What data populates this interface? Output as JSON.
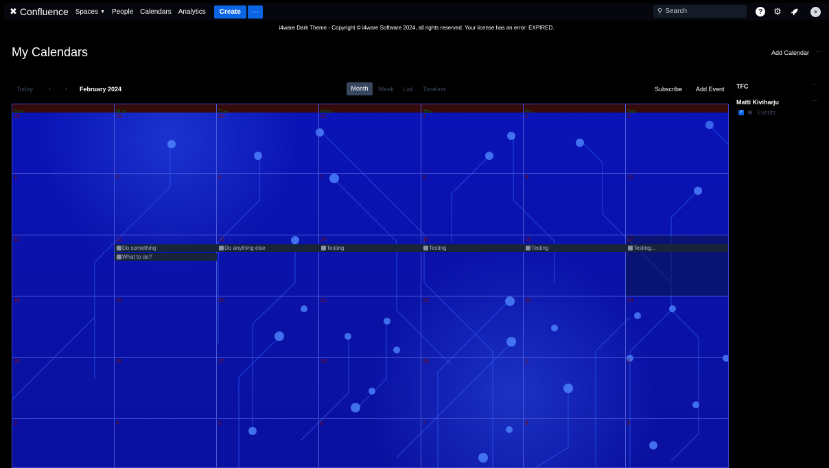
{
  "nav": {
    "logo": "Confluence",
    "links": [
      "Spaces",
      "People",
      "Calendars",
      "Analytics"
    ],
    "create": "Create",
    "more": "···",
    "search_placeholder": "Search"
  },
  "banner": "i4ware Dark Theme - Copyright © i4ware Software 2024, all rights reserved. Your license has an error: EXPIRED.",
  "page": {
    "title": "My Calendars",
    "add_calendar": "Add Calendar",
    "more": "···"
  },
  "toolbar": {
    "today": "Today",
    "prev": "‹",
    "next": "›",
    "period": "February 2024",
    "views": [
      "Month",
      "Week",
      "List",
      "Timeline"
    ],
    "active_view": "Month",
    "subscribe": "Subscribe",
    "add_event": "Add Event"
  },
  "calendar": {
    "weekdays": [
      "Sun",
      "Mon",
      "Tue",
      "Wed",
      "Thu",
      "Fri",
      "Sat"
    ],
    "weeks": [
      [
        "28",
        "29",
        "30",
        "31",
        "1",
        "2",
        "3"
      ],
      [
        "4",
        "5",
        "6",
        "7",
        "8",
        "9",
        "10"
      ],
      [
        "11",
        "12",
        "13",
        "14",
        "15",
        "16",
        "17"
      ],
      [
        "18",
        "19",
        "20",
        "21",
        "22",
        "23",
        "24"
      ],
      [
        "25",
        "26",
        "27",
        "28",
        "29",
        "1",
        "2"
      ],
      [
        "3",
        "4",
        "5",
        "6",
        "7",
        "8",
        "9"
      ]
    ],
    "events": [
      {
        "title": "Do something"
      },
      {
        "title": "What to do?"
      },
      {
        "title": "Do anything else"
      },
      {
        "title": "Testing"
      },
      {
        "title": "Testing"
      },
      {
        "title": "Testing"
      },
      {
        "title": "Testing..."
      }
    ]
  },
  "sidebar": {
    "calendars": [
      {
        "name": "TFC",
        "more": "···"
      },
      {
        "name": "Matti Kiviharju",
        "more": "···",
        "subcalendar": "Events",
        "checked": true
      }
    ]
  },
  "colors": {
    "accent": "#0c66e4",
    "calendar_bg": "#0a12a8",
    "day_number": "#7a0d0d",
    "weekday_label": "#0f5d1a"
  }
}
